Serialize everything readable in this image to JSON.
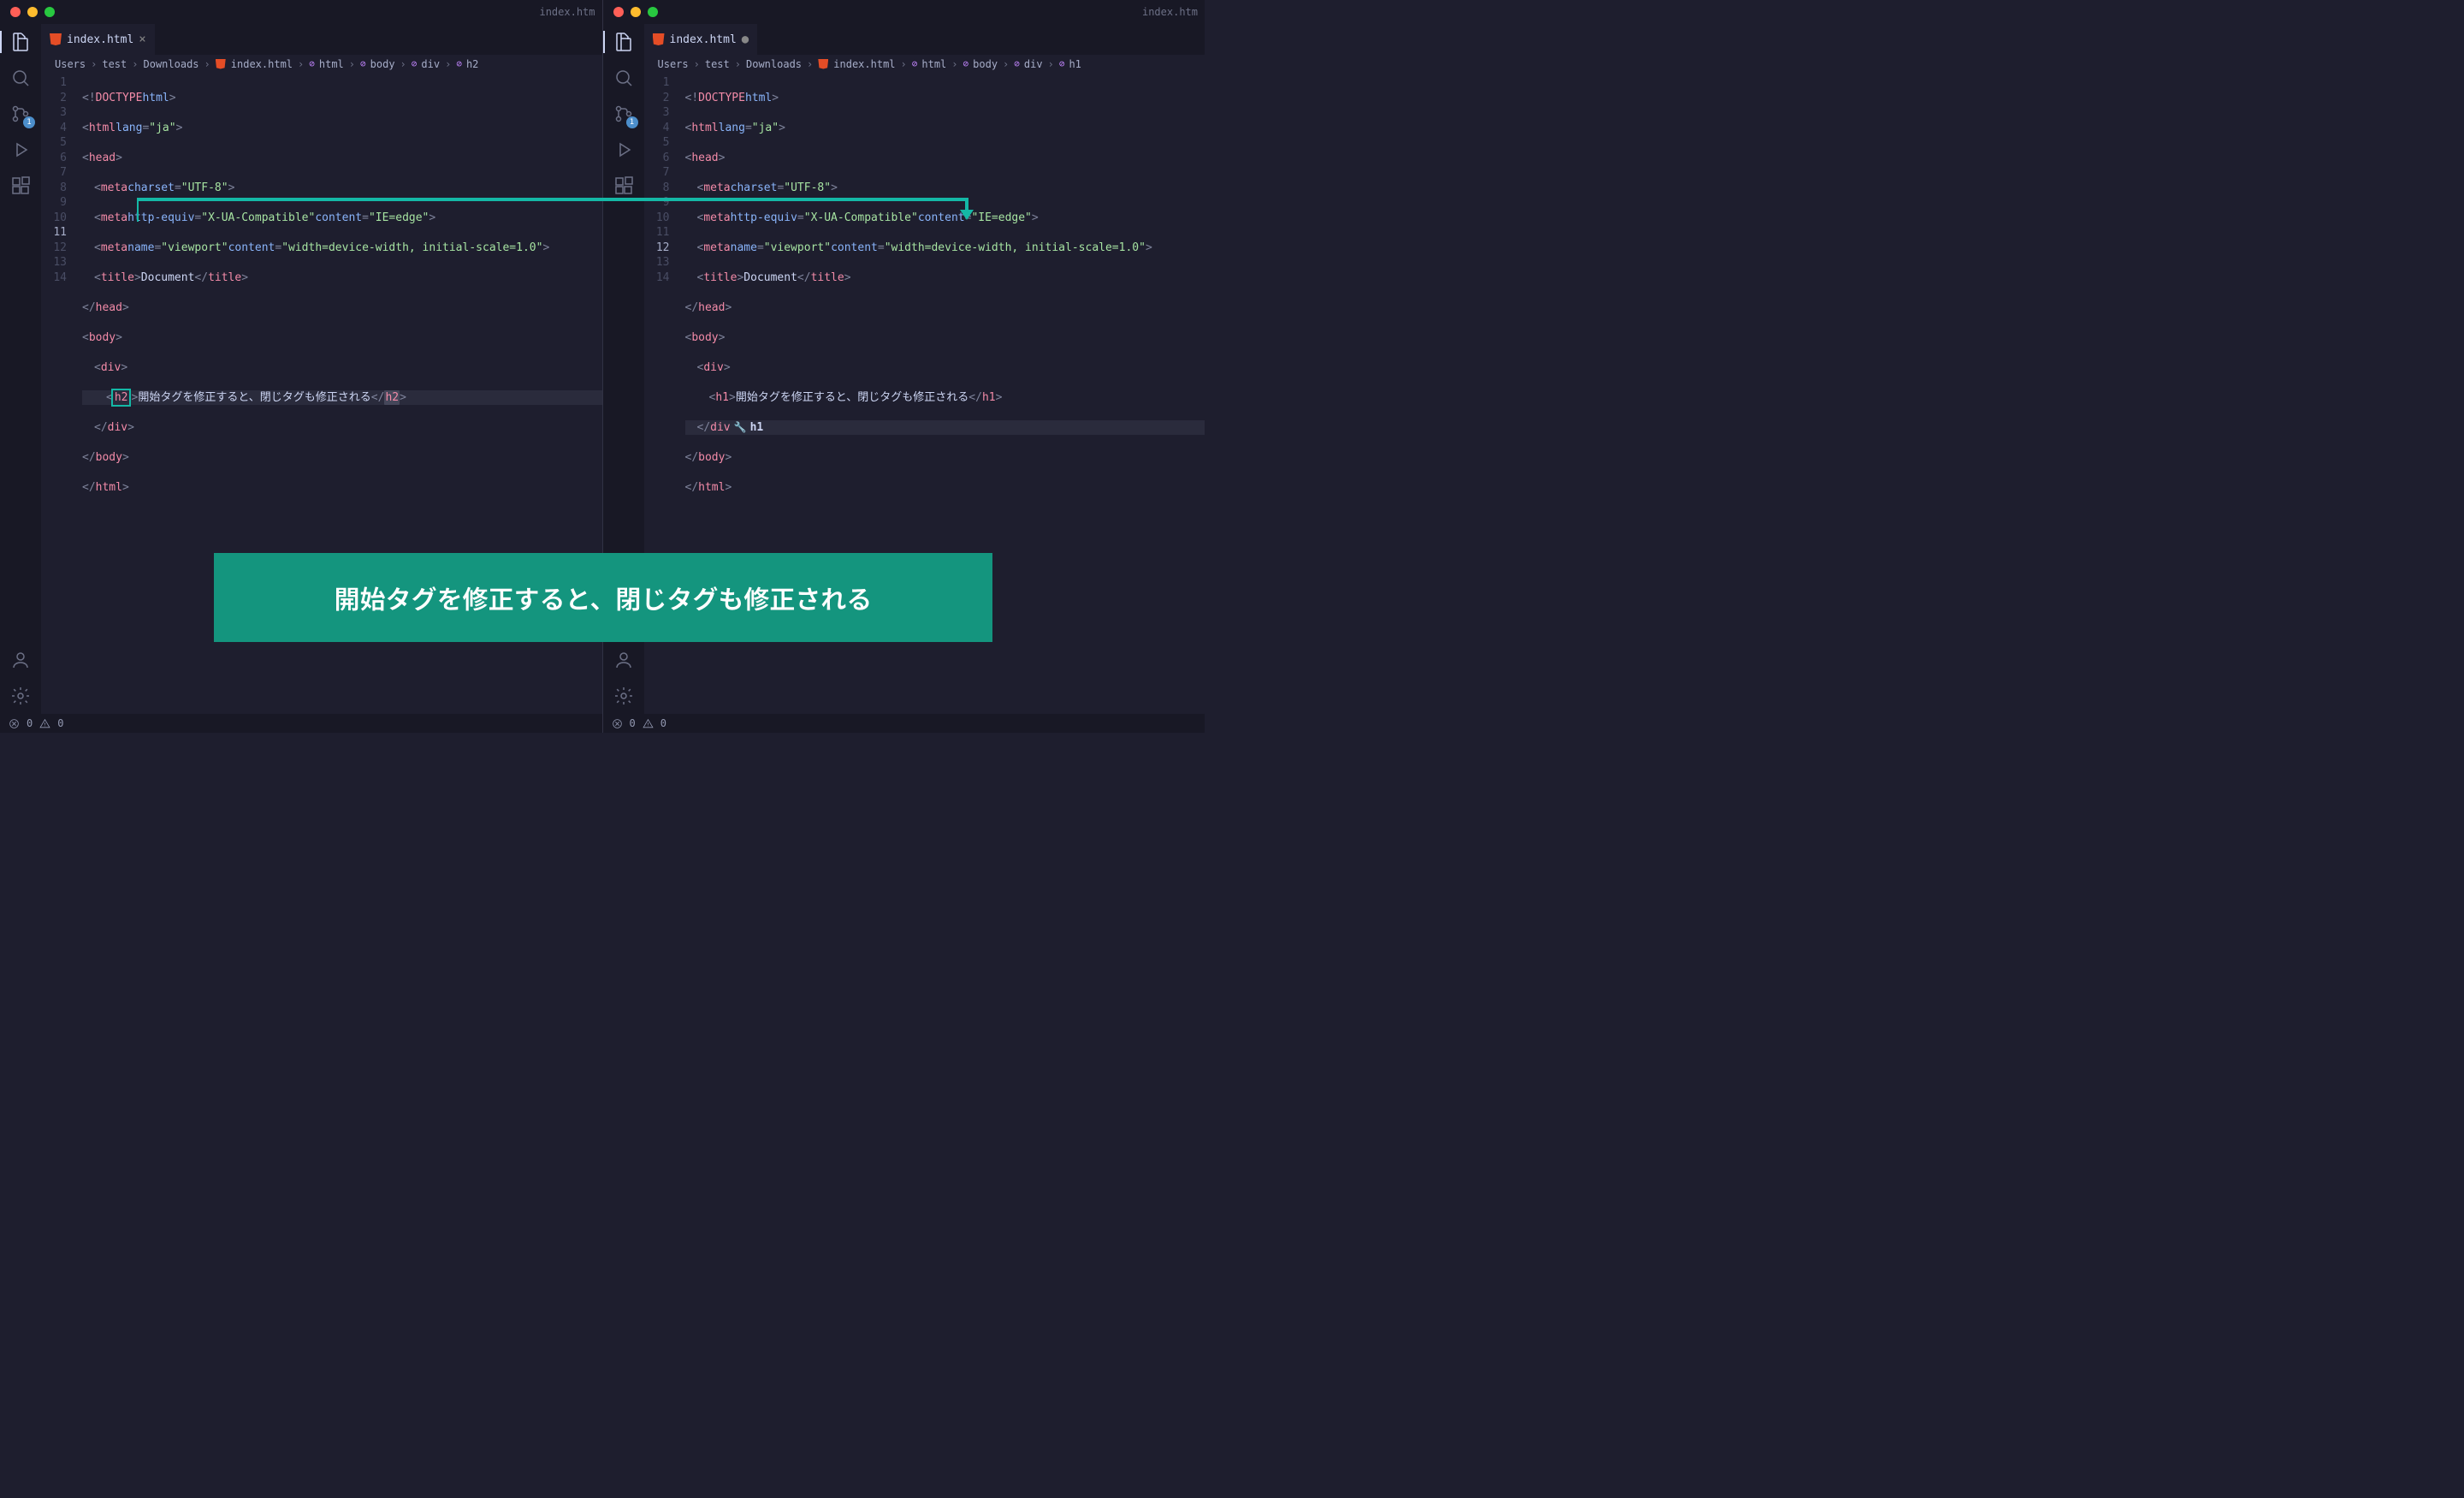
{
  "window_title": "index.htm",
  "left": {
    "tab": {
      "name": "index.html",
      "modified": false
    },
    "breadcrumbs": [
      "Users",
      "test",
      "Downloads",
      "index.html",
      "html",
      "body",
      "div",
      "h2"
    ],
    "line_numbers": [
      1,
      2,
      3,
      4,
      5,
      6,
      7,
      8,
      9,
      10,
      11,
      12,
      13,
      14
    ],
    "active_line": 11,
    "code": {
      "l1_tag": "DOCTYPE",
      "l1_attr": "html",
      "l2_tag": "html",
      "l2_attr": "lang",
      "l2_val": "\"ja\"",
      "l3_tag": "head",
      "l4_tag": "meta",
      "l4_attr": "charset",
      "l4_val": "\"UTF-8\"",
      "l5_tag": "meta",
      "l5_a1": "http-equiv",
      "l5_v1": "\"X-UA-Compatible\"",
      "l5_a2": "content",
      "l5_v2": "\"IE=edge\"",
      "l6_tag": "meta",
      "l6_a1": "name",
      "l6_v1": "\"viewport\"",
      "l6_a2": "content",
      "l6_v2": "\"width=device-width, initial-scale=1.0\"",
      "l7_tag": "title",
      "l7_txt": "Document",
      "l8_tag": "head",
      "l9_tag": "body",
      "l10_tag": "div",
      "l11_open": "h2",
      "l11_txt": "開始タグを修正すると、閉じタグも修正される",
      "l11_close": "h2",
      "l12_tag": "div",
      "l13_tag": "body",
      "l14_tag": "html"
    },
    "scm_badge": "1"
  },
  "right": {
    "tab": {
      "name": "index.html",
      "modified": true
    },
    "breadcrumbs": [
      "Users",
      "test",
      "Downloads",
      "index.html",
      "html",
      "body",
      "div",
      "h1"
    ],
    "line_numbers": [
      1,
      2,
      3,
      4,
      5,
      6,
      7,
      8,
      9,
      10,
      11,
      12,
      13,
      14
    ],
    "active_line": 12,
    "code": {
      "l11_open": "h1",
      "l11_txt": "開始タグを修正すると、閉じタグも修正される",
      "l11_close": "h1",
      "l12_tag": "div",
      "l12_hint": "h1"
    },
    "scm_badge": "1"
  },
  "caption": "開始タグを修正すると、閉じタグも修正される",
  "statusbar": {
    "errors": "0",
    "warnings": "0"
  }
}
